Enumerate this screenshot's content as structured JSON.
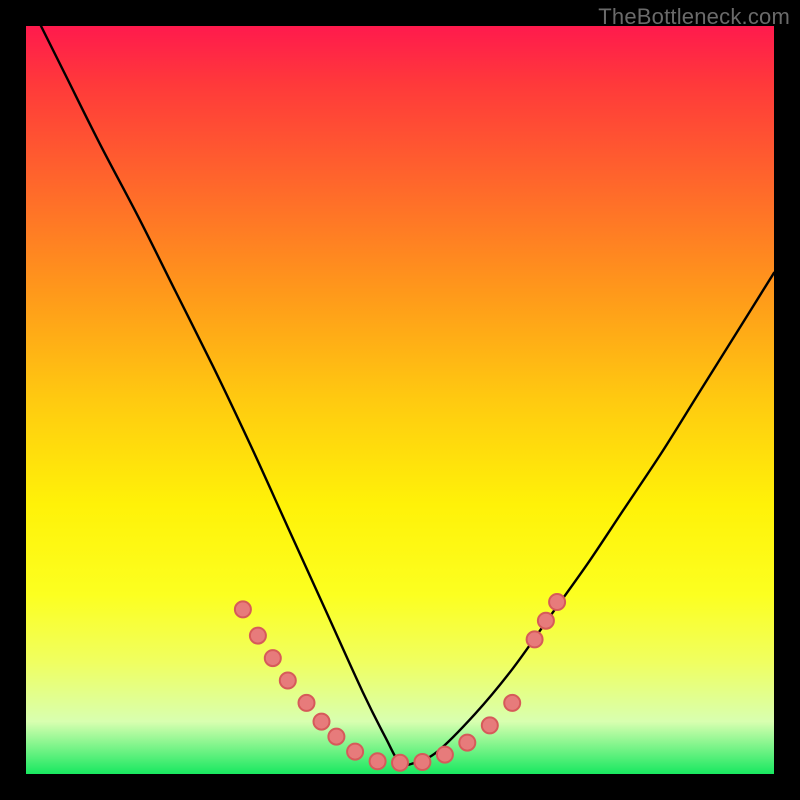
{
  "watermark": "TheBottleneck.com",
  "chart_data": {
    "type": "line",
    "title": "",
    "xlabel": "",
    "ylabel": "",
    "xlim": [
      0,
      100
    ],
    "ylim": [
      0,
      100
    ],
    "grid": false,
    "series": [
      {
        "name": "curve",
        "x": [
          2,
          5,
          10,
          15,
          20,
          25,
          30,
          35,
          40,
          45,
          48,
          50,
          52,
          55,
          60,
          65,
          70,
          75,
          80,
          85,
          90,
          95,
          100
        ],
        "y": [
          100,
          94,
          84,
          74.5,
          64.5,
          54.5,
          44,
          33,
          22,
          11,
          5,
          1.5,
          1.5,
          3,
          8,
          14,
          21,
          28,
          35.5,
          43,
          51,
          59,
          67
        ]
      }
    ],
    "markers": [
      {
        "x": 29,
        "y": 22
      },
      {
        "x": 31,
        "y": 18.5
      },
      {
        "x": 33,
        "y": 15.5
      },
      {
        "x": 35,
        "y": 12.5
      },
      {
        "x": 37.5,
        "y": 9.5
      },
      {
        "x": 39.5,
        "y": 7
      },
      {
        "x": 41.5,
        "y": 5
      },
      {
        "x": 44,
        "y": 3
      },
      {
        "x": 47,
        "y": 1.7
      },
      {
        "x": 50,
        "y": 1.5
      },
      {
        "x": 53,
        "y": 1.6
      },
      {
        "x": 56,
        "y": 2.6
      },
      {
        "x": 59,
        "y": 4.2
      },
      {
        "x": 62,
        "y": 6.5
      },
      {
        "x": 65,
        "y": 9.5
      },
      {
        "x": 68,
        "y": 18
      },
      {
        "x": 69.5,
        "y": 20.5
      },
      {
        "x": 71,
        "y": 23
      }
    ]
  }
}
